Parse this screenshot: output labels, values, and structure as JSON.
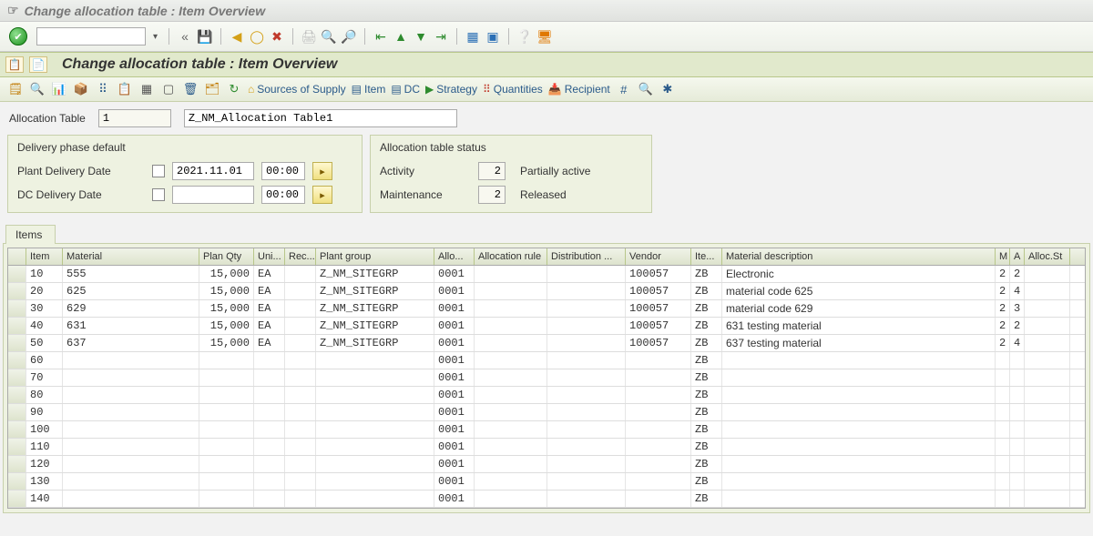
{
  "window": {
    "title": "Change allocation table : Item Overview"
  },
  "subheader": {
    "title": "Change allocation table : Item Overview"
  },
  "app_toolbar": {
    "sources": "Sources of Supply",
    "item": "Item",
    "dc": "DC",
    "strategy": "Strategy",
    "quantities": "Quantities",
    "recipient": "Recipient"
  },
  "header": {
    "alloc_label": "Allocation Table",
    "alloc_no": "1",
    "alloc_name": "Z_NM_Allocation Table1"
  },
  "panel_delivery": {
    "title": "Delivery phase default",
    "plant_label": "Plant Delivery Date",
    "plant_date": "2021.11.01",
    "plant_time": "00:00",
    "dc_label": "DC Delivery Date",
    "dc_date": "",
    "dc_time": "00:00"
  },
  "panel_status": {
    "title": "Allocation table status",
    "activity_label": "Activity",
    "activity_val": "2",
    "activity_txt": "Partially active",
    "maint_label": "Maintenance",
    "maint_val": "2",
    "maint_txt": "Released"
  },
  "items": {
    "tab": "Items",
    "cols": {
      "item": "Item",
      "material": "Material",
      "plan_qty": "Plan Qty",
      "unit": "Uni...",
      "rec": "Rec...",
      "plant_group": "Plant group",
      "allo": "Allo...",
      "alloc_rule": "Allocation rule",
      "dist": "Distribution ...",
      "vendor": "Vendor",
      "ite": "Ite...",
      "desc": "Material description",
      "m": "M",
      "a": "A",
      "allocst": "Alloc.St"
    },
    "rows": [
      {
        "item": "10",
        "material": "555",
        "qty": "15,000",
        "unit": "EA",
        "rec": "",
        "pg": "Z_NM_SITEGRP",
        "allo": "0001",
        "ar": "",
        "dist": "",
        "vendor": "100057",
        "ite": "ZB",
        "desc": "Electronic",
        "m": "2",
        "a": "2",
        "as": ""
      },
      {
        "item": "20",
        "material": "625",
        "qty": "15,000",
        "unit": "EA",
        "rec": "",
        "pg": "Z_NM_SITEGRP",
        "allo": "0001",
        "ar": "",
        "dist": "",
        "vendor": "100057",
        "ite": "ZB",
        "desc": "material code 625",
        "m": "2",
        "a": "4",
        "as": ""
      },
      {
        "item": "30",
        "material": "629",
        "qty": "15,000",
        "unit": "EA",
        "rec": "",
        "pg": "Z_NM_SITEGRP",
        "allo": "0001",
        "ar": "",
        "dist": "",
        "vendor": "100057",
        "ite": "ZB",
        "desc": "material code 629",
        "m": "2",
        "a": "3",
        "as": ""
      },
      {
        "item": "40",
        "material": "631",
        "qty": "15,000",
        "unit": "EA",
        "rec": "",
        "pg": "Z_NM_SITEGRP",
        "allo": "0001",
        "ar": "",
        "dist": "",
        "vendor": "100057",
        "ite": "ZB",
        "desc": "631 testing material",
        "m": "2",
        "a": "2",
        "as": ""
      },
      {
        "item": "50",
        "material": "637",
        "qty": "15,000",
        "unit": "EA",
        "rec": "",
        "pg": "Z_NM_SITEGRP",
        "allo": "0001",
        "ar": "",
        "dist": "",
        "vendor": "100057",
        "ite": "ZB",
        "desc": "637 testing material",
        "m": "2",
        "a": "4",
        "as": ""
      },
      {
        "item": "60",
        "material": "",
        "qty": "",
        "unit": "",
        "rec": "",
        "pg": "",
        "allo": "0001",
        "ar": "",
        "dist": "",
        "vendor": "",
        "ite": "ZB",
        "desc": "",
        "m": "",
        "a": "",
        "as": ""
      },
      {
        "item": "70",
        "material": "",
        "qty": "",
        "unit": "",
        "rec": "",
        "pg": "",
        "allo": "0001",
        "ar": "",
        "dist": "",
        "vendor": "",
        "ite": "ZB",
        "desc": "",
        "m": "",
        "a": "",
        "as": ""
      },
      {
        "item": "80",
        "material": "",
        "qty": "",
        "unit": "",
        "rec": "",
        "pg": "",
        "allo": "0001",
        "ar": "",
        "dist": "",
        "vendor": "",
        "ite": "ZB",
        "desc": "",
        "m": "",
        "a": "",
        "as": ""
      },
      {
        "item": "90",
        "material": "",
        "qty": "",
        "unit": "",
        "rec": "",
        "pg": "",
        "allo": "0001",
        "ar": "",
        "dist": "",
        "vendor": "",
        "ite": "ZB",
        "desc": "",
        "m": "",
        "a": "",
        "as": ""
      },
      {
        "item": "100",
        "material": "",
        "qty": "",
        "unit": "",
        "rec": "",
        "pg": "",
        "allo": "0001",
        "ar": "",
        "dist": "",
        "vendor": "",
        "ite": "ZB",
        "desc": "",
        "m": "",
        "a": "",
        "as": ""
      },
      {
        "item": "110",
        "material": "",
        "qty": "",
        "unit": "",
        "rec": "",
        "pg": "",
        "allo": "0001",
        "ar": "",
        "dist": "",
        "vendor": "",
        "ite": "ZB",
        "desc": "",
        "m": "",
        "a": "",
        "as": ""
      },
      {
        "item": "120",
        "material": "",
        "qty": "",
        "unit": "",
        "rec": "",
        "pg": "",
        "allo": "0001",
        "ar": "",
        "dist": "",
        "vendor": "",
        "ite": "ZB",
        "desc": "",
        "m": "",
        "a": "",
        "as": ""
      },
      {
        "item": "130",
        "material": "",
        "qty": "",
        "unit": "",
        "rec": "",
        "pg": "",
        "allo": "0001",
        "ar": "",
        "dist": "",
        "vendor": "",
        "ite": "ZB",
        "desc": "",
        "m": "",
        "a": "",
        "as": ""
      },
      {
        "item": "140",
        "material": "",
        "qty": "",
        "unit": "",
        "rec": "",
        "pg": "",
        "allo": "0001",
        "ar": "",
        "dist": "",
        "vendor": "",
        "ite": "ZB",
        "desc": "",
        "m": "",
        "a": "",
        "as": ""
      }
    ]
  }
}
